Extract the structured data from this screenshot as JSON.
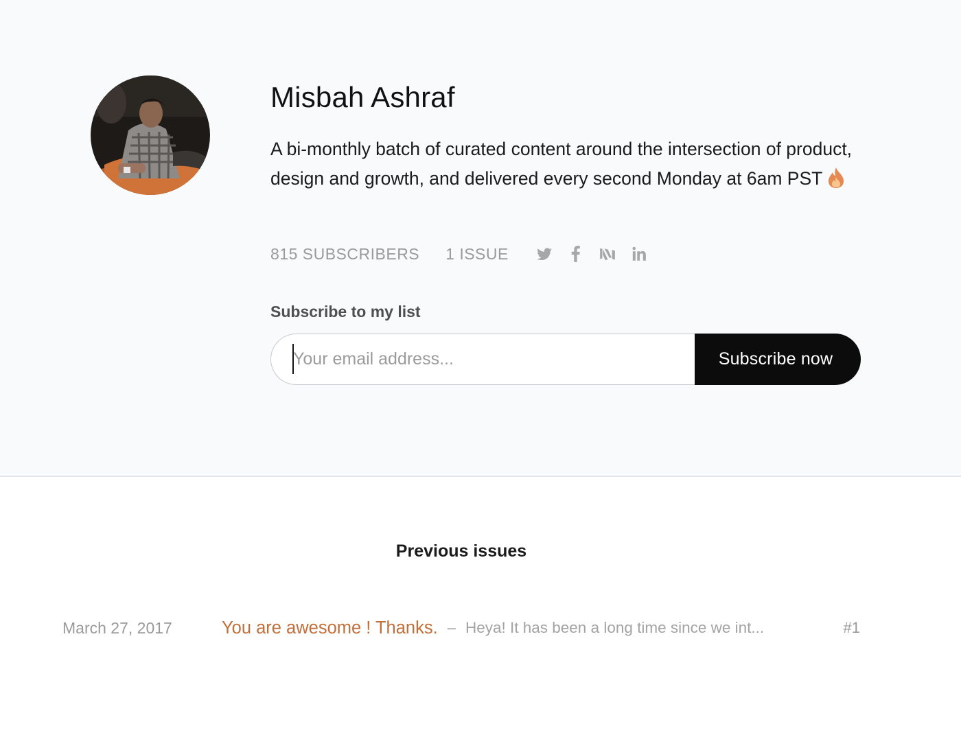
{
  "profile": {
    "name": "Misbah Ashraf",
    "bio": "A bi-monthly batch of curated content around the intersection of product, design and growth, and delivered every second Monday at 6am PST",
    "bio_emoji_icon": "fire-icon",
    "subscribers": "815 SUBSCRIBERS",
    "issues": "1 ISSUE",
    "socials": [
      "twitter-icon",
      "facebook-icon",
      "medium-icon",
      "linkedin-icon"
    ]
  },
  "subscribe": {
    "label": "Subscribe to my list",
    "email_placeholder": "Your email address...",
    "email_value": "",
    "button_label": "Subscribe now"
  },
  "previous": {
    "title": "Previous issues",
    "issues": [
      {
        "date": "March 27, 2017",
        "title": "You are awesome ! Thanks.",
        "separator": "–",
        "excerpt": "Heya! It has been a long time since we int...",
        "number": "#1"
      }
    ]
  },
  "colors": {
    "hero_bg": "#f9fafc",
    "accent": "#c06f3b",
    "button_bg": "#0c0c0c",
    "muted_text": "#9a9a9a"
  }
}
